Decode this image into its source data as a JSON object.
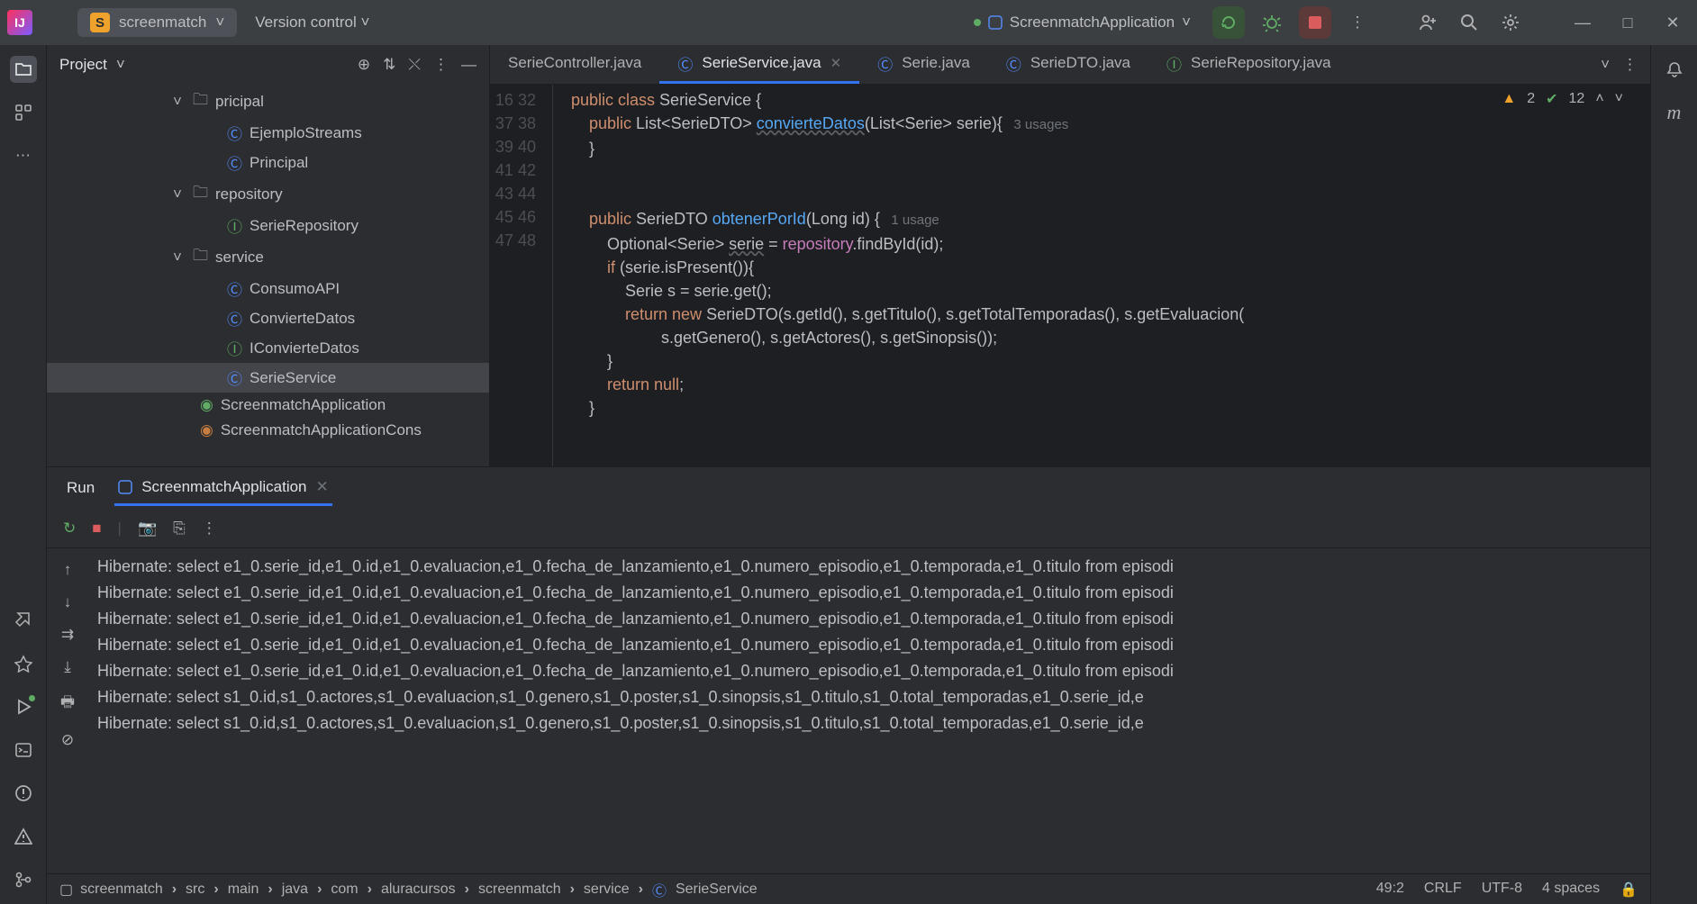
{
  "titlebar": {
    "project_badge": "S",
    "project_name": "screenmatch",
    "vcs_label": "Version control",
    "run_config": "ScreenmatchApplication"
  },
  "project_panel": {
    "title": "Project",
    "tree": {
      "folder_principal": "pricipal",
      "file_ejemplo": "EjemploStreams",
      "file_principal": "Principal",
      "folder_repository": "repository",
      "file_serierepo": "SerieRepository",
      "folder_service": "service",
      "file_consumoapi": "ConsumoAPI",
      "file_conviertedatos": "ConvierteDatos",
      "file_iconviertedatos": "IConvierteDatos",
      "file_serieservice": "SerieService",
      "file_app": "ScreenmatchApplication",
      "file_appconsole": "ScreenmatchApplicationCons"
    }
  },
  "editor": {
    "tabs": [
      {
        "label": "SerieController.java",
        "icon": "c",
        "active": false
      },
      {
        "label": "SerieService.java",
        "icon": "c",
        "active": true,
        "closable": true
      },
      {
        "label": "Serie.java",
        "icon": "c",
        "active": false
      },
      {
        "label": "SerieDTO.java",
        "icon": "c",
        "active": false
      },
      {
        "label": "SerieRepository.java",
        "icon": "i",
        "active": false
      }
    ],
    "inspections": {
      "warnings": "2",
      "checks": "12"
    },
    "gutter": [
      "16",
      "32",
      "37",
      "38",
      "39",
      "40",
      "41",
      "42",
      "43",
      "44",
      "45",
      "46",
      "47",
      "48"
    ],
    "code_lines": {
      "l16": {
        "p1": "public class ",
        "p2": "SerieService ",
        "p3": "{"
      },
      "l32": {
        "p1": "    public ",
        "p2": "List<SerieDTO> ",
        "p3": "convierteDatos",
        "p4": "(List<Serie> serie){",
        "u": "   3 usages"
      },
      "l37": "    }",
      "l38": "",
      "l39": "",
      "l40": {
        "p1": "    public ",
        "p2": "SerieDTO ",
        "p3": "obtenerPorId",
        "p4": "(Long id) {",
        "u": "   1 usage"
      },
      "l41": {
        "p1": "        Optional<Serie> ",
        "p2": "serie",
        " p3": " = ",
        "p4": "repository",
        "p5": ".findById(id);"
      },
      "l42": {
        "p1": "        if ",
        "p2": "(serie.isPresent()){"
      },
      "l43": "            Serie s = serie.get();",
      "l44": {
        "p1": "            return new ",
        "p2": "SerieDTO(s.getId(), s.getTitulo(), s.getTotalTemporadas(), s.getEvaluacion("
      },
      "l45": "                    s.getGenero(), s.getActores(), s.getSinopsis());",
      "l46": "        }",
      "l47": {
        "p1": "        return null",
        ";": ";"
      },
      "l48": "    }"
    }
  },
  "run": {
    "label": "Run",
    "tab": "ScreenmatchApplication",
    "console_lines": [
      "Hibernate: select e1_0.serie_id,e1_0.id,e1_0.evaluacion,e1_0.fecha_de_lanzamiento,e1_0.numero_episodio,e1_0.temporada,e1_0.titulo from episodi",
      "Hibernate: select e1_0.serie_id,e1_0.id,e1_0.evaluacion,e1_0.fecha_de_lanzamiento,e1_0.numero_episodio,e1_0.temporada,e1_0.titulo from episodi",
      "Hibernate: select e1_0.serie_id,e1_0.id,e1_0.evaluacion,e1_0.fecha_de_lanzamiento,e1_0.numero_episodio,e1_0.temporada,e1_0.titulo from episodi",
      "Hibernate: select e1_0.serie_id,e1_0.id,e1_0.evaluacion,e1_0.fecha_de_lanzamiento,e1_0.numero_episodio,e1_0.temporada,e1_0.titulo from episodi",
      "Hibernate: select e1_0.serie_id,e1_0.id,e1_0.evaluacion,e1_0.fecha_de_lanzamiento,e1_0.numero_episodio,e1_0.temporada,e1_0.titulo from episodi",
      "Hibernate: select s1_0.id,s1_0.actores,s1_0.evaluacion,s1_0.genero,s1_0.poster,s1_0.sinopsis,s1_0.titulo,s1_0.total_temporadas,e1_0.serie_id,e",
      "Hibernate: select s1_0.id,s1_0.actores,s1_0.evaluacion,s1_0.genero,s1_0.poster,s1_0.sinopsis,s1_0.titulo,s1_0.total_temporadas,e1_0.serie_id,e"
    ]
  },
  "statusbar": {
    "crumbs": [
      "screenmatch",
      "src",
      "main",
      "java",
      "com",
      "aluracursos",
      "screenmatch",
      "service",
      "SerieService"
    ],
    "pos": "49:2",
    "sep": "CRLF",
    "enc": "UTF-8",
    "indent": "4 spaces"
  }
}
